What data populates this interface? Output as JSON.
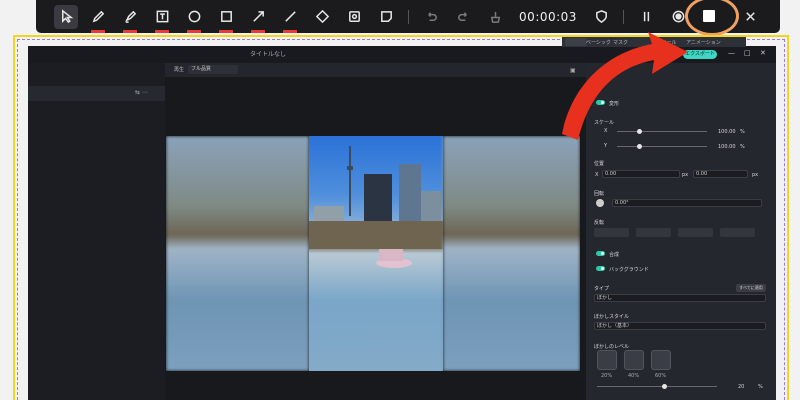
{
  "toolbar": {
    "tools": [
      "pointer-icon",
      "pen-icon",
      "highlighter-icon",
      "text-icon",
      "circle-icon",
      "rectangle-icon",
      "arrow-icon",
      "line-icon",
      "eraser-icon",
      "camera-icon",
      "sticky-icon"
    ],
    "timer": "00:00:03"
  },
  "window": {
    "title": "タイトルなし",
    "export_label": "エクスポート",
    "controls": [
      "—",
      "□",
      "✕"
    ]
  },
  "preview": {
    "zoom": "再生",
    "quality": "フル品質"
  },
  "panel": {
    "tabs": [
      "ベーシック",
      "マスク",
      "AI ツール",
      "アニメーション"
    ],
    "transform": "変形",
    "scale": "スケール",
    "x": "X",
    "y": "Y",
    "scale_x": "100.00",
    "scale_y": "100.00",
    "unit": "%",
    "position": "位置",
    "pos_x": "0.00",
    "pos_y": "0.00",
    "px": "px",
    "rotate": "回転",
    "rotate_value": "0.00°",
    "flip": "反転",
    "composite": "合成",
    "background": "バックグラウンド",
    "type": "タイプ",
    "apply_all": "すべてに適用",
    "blur": "ぼかし",
    "blur_style": "ぼかしスタイル",
    "blur_style_value": "ぼかし（基本）",
    "blur_level": "ぼかしのレベル",
    "levels": [
      "20%",
      "40%",
      "60%"
    ],
    "level_value": "20",
    "percent": "%"
  },
  "colors": {
    "accent": "#2ec7a5",
    "annotation": "#e8301e",
    "highlight_ring": "#f0a060",
    "record_frame": "#f3d51f"
  }
}
